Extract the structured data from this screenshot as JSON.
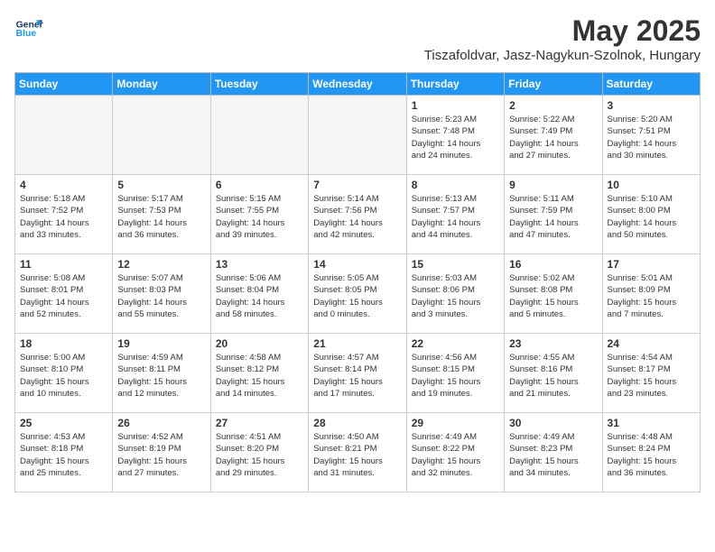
{
  "header": {
    "logo_line1": "General",
    "logo_line2": "Blue",
    "month_title": "May 2025",
    "location": "Tiszafoldvar, Jasz-Nagykun-Szolnok, Hungary"
  },
  "weekdays": [
    "Sunday",
    "Monday",
    "Tuesday",
    "Wednesday",
    "Thursday",
    "Friday",
    "Saturday"
  ],
  "weeks": [
    [
      {
        "day": "",
        "info": ""
      },
      {
        "day": "",
        "info": ""
      },
      {
        "day": "",
        "info": ""
      },
      {
        "day": "",
        "info": ""
      },
      {
        "day": "1",
        "info": "Sunrise: 5:23 AM\nSunset: 7:48 PM\nDaylight: 14 hours\nand 24 minutes."
      },
      {
        "day": "2",
        "info": "Sunrise: 5:22 AM\nSunset: 7:49 PM\nDaylight: 14 hours\nand 27 minutes."
      },
      {
        "day": "3",
        "info": "Sunrise: 5:20 AM\nSunset: 7:51 PM\nDaylight: 14 hours\nand 30 minutes."
      }
    ],
    [
      {
        "day": "4",
        "info": "Sunrise: 5:18 AM\nSunset: 7:52 PM\nDaylight: 14 hours\nand 33 minutes."
      },
      {
        "day": "5",
        "info": "Sunrise: 5:17 AM\nSunset: 7:53 PM\nDaylight: 14 hours\nand 36 minutes."
      },
      {
        "day": "6",
        "info": "Sunrise: 5:15 AM\nSunset: 7:55 PM\nDaylight: 14 hours\nand 39 minutes."
      },
      {
        "day": "7",
        "info": "Sunrise: 5:14 AM\nSunset: 7:56 PM\nDaylight: 14 hours\nand 42 minutes."
      },
      {
        "day": "8",
        "info": "Sunrise: 5:13 AM\nSunset: 7:57 PM\nDaylight: 14 hours\nand 44 minutes."
      },
      {
        "day": "9",
        "info": "Sunrise: 5:11 AM\nSunset: 7:59 PM\nDaylight: 14 hours\nand 47 minutes."
      },
      {
        "day": "10",
        "info": "Sunrise: 5:10 AM\nSunset: 8:00 PM\nDaylight: 14 hours\nand 50 minutes."
      }
    ],
    [
      {
        "day": "11",
        "info": "Sunrise: 5:08 AM\nSunset: 8:01 PM\nDaylight: 14 hours\nand 52 minutes."
      },
      {
        "day": "12",
        "info": "Sunrise: 5:07 AM\nSunset: 8:03 PM\nDaylight: 14 hours\nand 55 minutes."
      },
      {
        "day": "13",
        "info": "Sunrise: 5:06 AM\nSunset: 8:04 PM\nDaylight: 14 hours\nand 58 minutes."
      },
      {
        "day": "14",
        "info": "Sunrise: 5:05 AM\nSunset: 8:05 PM\nDaylight: 15 hours\nand 0 minutes."
      },
      {
        "day": "15",
        "info": "Sunrise: 5:03 AM\nSunset: 8:06 PM\nDaylight: 15 hours\nand 3 minutes."
      },
      {
        "day": "16",
        "info": "Sunrise: 5:02 AM\nSunset: 8:08 PM\nDaylight: 15 hours\nand 5 minutes."
      },
      {
        "day": "17",
        "info": "Sunrise: 5:01 AM\nSunset: 8:09 PM\nDaylight: 15 hours\nand 7 minutes."
      }
    ],
    [
      {
        "day": "18",
        "info": "Sunrise: 5:00 AM\nSunset: 8:10 PM\nDaylight: 15 hours\nand 10 minutes."
      },
      {
        "day": "19",
        "info": "Sunrise: 4:59 AM\nSunset: 8:11 PM\nDaylight: 15 hours\nand 12 minutes."
      },
      {
        "day": "20",
        "info": "Sunrise: 4:58 AM\nSunset: 8:12 PM\nDaylight: 15 hours\nand 14 minutes."
      },
      {
        "day": "21",
        "info": "Sunrise: 4:57 AM\nSunset: 8:14 PM\nDaylight: 15 hours\nand 17 minutes."
      },
      {
        "day": "22",
        "info": "Sunrise: 4:56 AM\nSunset: 8:15 PM\nDaylight: 15 hours\nand 19 minutes."
      },
      {
        "day": "23",
        "info": "Sunrise: 4:55 AM\nSunset: 8:16 PM\nDaylight: 15 hours\nand 21 minutes."
      },
      {
        "day": "24",
        "info": "Sunrise: 4:54 AM\nSunset: 8:17 PM\nDaylight: 15 hours\nand 23 minutes."
      }
    ],
    [
      {
        "day": "25",
        "info": "Sunrise: 4:53 AM\nSunset: 8:18 PM\nDaylight: 15 hours\nand 25 minutes."
      },
      {
        "day": "26",
        "info": "Sunrise: 4:52 AM\nSunset: 8:19 PM\nDaylight: 15 hours\nand 27 minutes."
      },
      {
        "day": "27",
        "info": "Sunrise: 4:51 AM\nSunset: 8:20 PM\nDaylight: 15 hours\nand 29 minutes."
      },
      {
        "day": "28",
        "info": "Sunrise: 4:50 AM\nSunset: 8:21 PM\nDaylight: 15 hours\nand 31 minutes."
      },
      {
        "day": "29",
        "info": "Sunrise: 4:49 AM\nSunset: 8:22 PM\nDaylight: 15 hours\nand 32 minutes."
      },
      {
        "day": "30",
        "info": "Sunrise: 4:49 AM\nSunset: 8:23 PM\nDaylight: 15 hours\nand 34 minutes."
      },
      {
        "day": "31",
        "info": "Sunrise: 4:48 AM\nSunset: 8:24 PM\nDaylight: 15 hours\nand 36 minutes."
      }
    ]
  ]
}
